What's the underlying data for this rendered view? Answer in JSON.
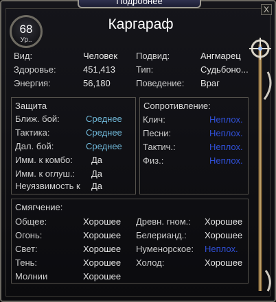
{
  "window": {
    "tab_title": "Подробнее",
    "close_label": "X",
    "level": "68",
    "level_label": "Ур..",
    "name": "Каргараф"
  },
  "info": {
    "rows": [
      {
        "l1": "Вид:",
        "v1": "Человек",
        "l2": "Подвид:",
        "v2": "Ангмарец"
      },
      {
        "l1": "Здоровье:",
        "v1": "451,413",
        "l2": "Тип:",
        "v2": "Судьбоно..."
      },
      {
        "l1": "Энергия:",
        "v1": "56,180",
        "l2": "Поведение:",
        "v2": "Враг"
      }
    ]
  },
  "defense": {
    "title": "Защита",
    "rows": [
      {
        "label": "Ближ. бой:",
        "value": "Среднее"
      },
      {
        "label": "Тактика:",
        "value": "Среднее"
      },
      {
        "label": "Дал. бой:",
        "value": "Среднее"
      },
      {
        "label": "Имм. к комбо:",
        "value": "Да"
      },
      {
        "label": "Имм. к оглуш.:",
        "value": "Да"
      },
      {
        "label": "Неуязвимость к",
        "value": "Да"
      }
    ]
  },
  "resistance": {
    "title": "Сопротивление:",
    "rows": [
      {
        "label": "Клич:",
        "value": "Неплох."
      },
      {
        "label": "Песни:",
        "value": "Неплох."
      },
      {
        "label": "Тактич.:",
        "value": "Неплох."
      },
      {
        "label": "Физ.:",
        "value": "Неплох."
      }
    ]
  },
  "mitigation": {
    "title": "Смягчение:",
    "left": [
      {
        "label": "Общее:",
        "value": "Хорошее"
      },
      {
        "label": "Огонь:",
        "value": "Хорошее"
      },
      {
        "label": "Свет:",
        "value": "Хорошее"
      },
      {
        "label": "Тень:",
        "value": "Хорошее"
      },
      {
        "label": "Молнии",
        "value": "Хорошее"
      }
    ],
    "right": [
      {
        "label": "Древн. гном.:",
        "value": "Хорошее"
      },
      {
        "label": "Белерианд.:",
        "value": "Хорошее"
      },
      {
        "label": "Нуменорское:",
        "value": "Неплох."
      },
      {
        "label": "Холод:",
        "value": "Хорошее"
      }
    ]
  },
  "colors": {
    "good": "#e6e6e6",
    "average": "#6fb7d8",
    "poor": "#3050d8",
    "frame": "#6d6a63"
  },
  "icons": [
    "close-icon",
    "staff-icon",
    "level-badge-icon"
  ]
}
